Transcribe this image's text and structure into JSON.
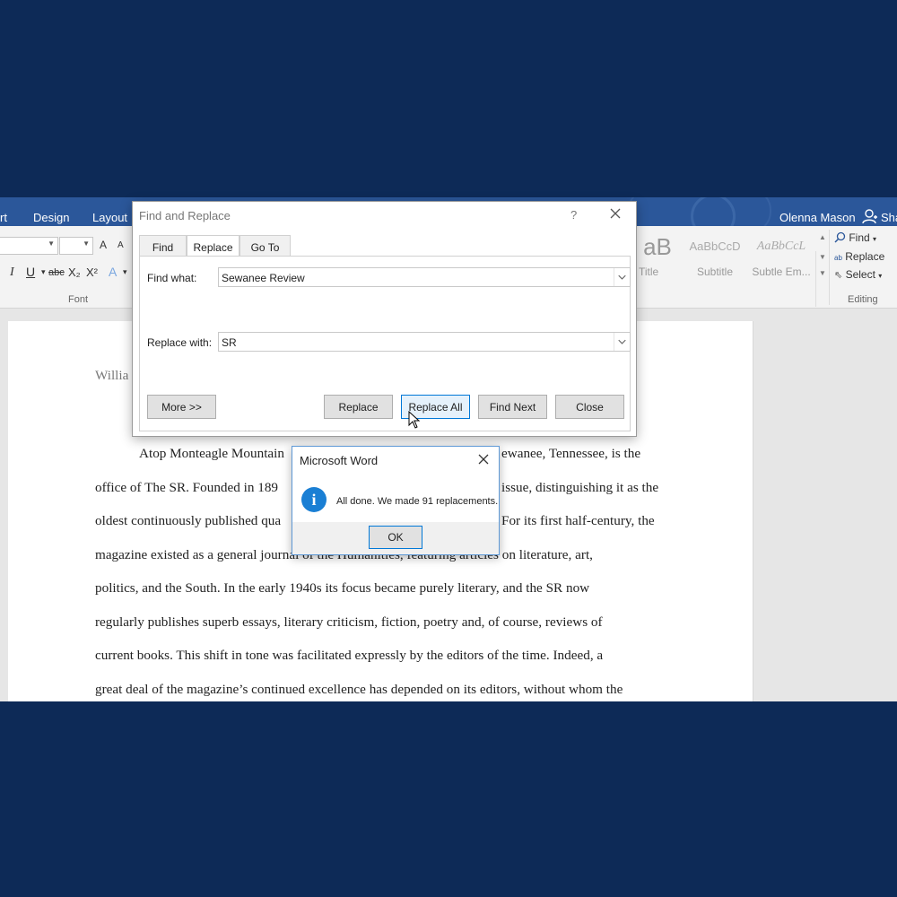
{
  "ribbon": {
    "tabs": [
      "rt",
      "Design",
      "Layout"
    ],
    "user": "Olenna Mason",
    "share": "Sha",
    "font_group_label": "Font",
    "editing_group_label": "Editing",
    "font_buttons": [
      "A",
      "A",
      "I",
      "U",
      "abc",
      "X₂",
      "X²",
      "A"
    ],
    "styles": [
      {
        "sample": "aB",
        "name": "Title"
      },
      {
        "sample": "AaBbCcD",
        "name": "Subtitle"
      },
      {
        "sample": "AaBbCcL",
        "name": "Subtle Em..."
      }
    ],
    "editing": {
      "find": "Find",
      "replace": "Replace",
      "select": "Select"
    }
  },
  "document": {
    "author_fragment": "Willia",
    "lines": [
      {
        "text": "Atop Monteagle Mountain"
      },
      {
        "text": "office of The SR. Founded in 189"
      },
      {
        "text": "oldest continuously published qua"
      },
      {
        "text": "magazine existed as a general journal of the Humanities, featuring articles on literature, art,"
      },
      {
        "text": "politics, and the South. In the early 1940s its focus became purely literary, and the SR now"
      },
      {
        "text": "regularly publishes superb essays, literary criticism, fiction, poetry and, of course, reviews of"
      },
      {
        "text": "current books. This shift in tone was facilitated expressly by the editors of the time. Indeed, a"
      },
      {
        "text": "great deal of the magazine’s continued excellence has depended on its editors, without whom the"
      }
    ],
    "right_fragments": [
      {
        "text": "ewanee, Tennessee, is the"
      },
      {
        "text": "issue, distinguishing it as the"
      },
      {
        "text": "For its first half-century, the"
      }
    ]
  },
  "find_dialog": {
    "title": "Find and Replace",
    "help": "?",
    "tabs": [
      "Find",
      "Replace",
      "Go To"
    ],
    "find_label": "Find what:",
    "find_value": "Sewanee Review",
    "replace_label": "Replace with:",
    "replace_value": "SR",
    "buttons": {
      "more": "More >>",
      "replace": "Replace",
      "replace_all": "Replace All",
      "find_next": "Find Next",
      "close": "Close"
    }
  },
  "message_box": {
    "title": "Microsoft Word",
    "message": "All done. We made 91 replacements.",
    "ok": "OK"
  },
  "colors": {
    "frame": "#0d2a57",
    "ribbon": "#2b579a",
    "info_icon": "#1a7fd4",
    "focus_border": "#0078d7"
  }
}
